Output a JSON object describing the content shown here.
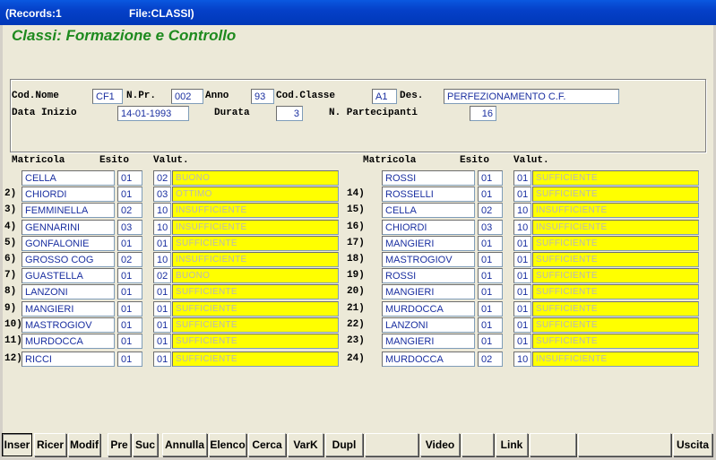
{
  "window": {
    "records": "(Records:1",
    "file": "File:CLASSI)"
  },
  "form": {
    "title": "Classi: Formazione e Controllo"
  },
  "header": {
    "cod_nome": {
      "label": "Cod.Nome",
      "value": "CF1"
    },
    "n_pr": {
      "label": "N.Pr.",
      "value": "002"
    },
    "anno": {
      "label": "Anno",
      "value": "93"
    },
    "cod_classe": {
      "label": "Cod.Classe",
      "value": "A1"
    },
    "des": {
      "label": "Des.",
      "value": "PERFEZIONAMENTO C.F."
    },
    "data_inizio": {
      "label": "Data Inizio",
      "value": "14-01-1993"
    },
    "durata": {
      "label": "Durata",
      "value": "3"
    },
    "n_partecipanti": {
      "label": "N. Partecipanti",
      "value": "16"
    }
  },
  "columns": {
    "matricola": "Matricola",
    "esito": "Esito",
    "valut": "Valut."
  },
  "left_rows": [
    {
      "num": "",
      "matricola": "CELLA",
      "esito": "01",
      "code": "02",
      "desc": "BUONO"
    },
    {
      "num": "2)",
      "matricola": "CHIORDI",
      "esito": "01",
      "code": "03",
      "desc": "OTTIMO"
    },
    {
      "num": "3)",
      "matricola": "FEMMINELLA",
      "esito": "02",
      "code": "10",
      "desc": "INSUFFICIENTE"
    },
    {
      "num": "4)",
      "matricola": "GENNARINI",
      "esito": "03",
      "code": "10",
      "desc": "INSUFFICIENTE"
    },
    {
      "num": "5)",
      "matricola": "GONFALONIE",
      "esito": "01",
      "code": "01",
      "desc": "SUFFICIENTE"
    },
    {
      "num": "6)",
      "matricola": "GROSSO COG",
      "esito": "02",
      "code": "10",
      "desc": "INSUFFICIENTE"
    },
    {
      "num": "7)",
      "matricola": "GUASTELLA",
      "esito": "01",
      "code": "02",
      "desc": "BUONO"
    },
    {
      "num": "8)",
      "matricola": "LANZONI",
      "esito": "01",
      "code": "01",
      "desc": "SUFFICIENTE"
    },
    {
      "num": "9)",
      "matricola": "MANGIERI",
      "esito": "01",
      "code": "01",
      "desc": "SUFFICIENTE"
    },
    {
      "num": "10)",
      "matricola": "MASTROGIOV",
      "esito": "01",
      "code": "01",
      "desc": "SUFFICIENTE"
    },
    {
      "num": "11)",
      "matricola": "MURDOCCA",
      "esito": "01",
      "code": "01",
      "desc": "SUFFICIENTE"
    },
    {
      "num": "12)",
      "matricola": "RICCI",
      "esito": "01",
      "code": "01",
      "desc": "SUFFICIENTE"
    }
  ],
  "right_rows": [
    {
      "num": "",
      "matricola": "ROSSI",
      "esito": "01",
      "code": "01",
      "desc": "SUFFICIENTE"
    },
    {
      "num": "14)",
      "matricola": "ROSSELLI",
      "esito": "01",
      "code": "01",
      "desc": "SUFFICIENTE"
    },
    {
      "num": "15)",
      "matricola": "CELLA",
      "esito": "02",
      "code": "10",
      "desc": "INSUFFICIENTE"
    },
    {
      "num": "16)",
      "matricola": "CHIORDI",
      "esito": "03",
      "code": "10",
      "desc": "INSUFFICIENTE"
    },
    {
      "num": "17)",
      "matricola": "MANGIERI",
      "esito": "01",
      "code": "01",
      "desc": "SUFFICIENTE"
    },
    {
      "num": "18)",
      "matricola": "MASTROGIOV",
      "esito": "01",
      "code": "01",
      "desc": "SUFFICIENTE"
    },
    {
      "num": "19)",
      "matricola": "ROSSI",
      "esito": "01",
      "code": "01",
      "desc": "SUFFICIENTE"
    },
    {
      "num": "20)",
      "matricola": "MANGIERI",
      "esito": "01",
      "code": "01",
      "desc": "SUFFICIENTE"
    },
    {
      "num": "21)",
      "matricola": "MURDOCCA",
      "esito": "01",
      "code": "01",
      "desc": "SUFFICIENTE"
    },
    {
      "num": "22)",
      "matricola": "LANZONI",
      "esito": "01",
      "code": "01",
      "desc": "SUFFICIENTE"
    },
    {
      "num": "23)",
      "matricola": "MANGIERI",
      "esito": "01",
      "code": "01",
      "desc": "SUFFICIENTE"
    },
    {
      "num": "24)",
      "matricola": "MURDOCCA",
      "esito": "02",
      "code": "10",
      "desc": "INSUFFICIENTE"
    }
  ],
  "toolbar": {
    "inser": "Inser",
    "ricer": "Ricer",
    "modif": "Modif",
    "pre": "Pre",
    "suc": "Suc",
    "annulla": "Annulla",
    "elenco": "Elenco",
    "cerca": "Cerca",
    "vark": "VarK",
    "dupl": "Dupl",
    "video": "Video",
    "link": "Link",
    "uscita": "Uscita"
  }
}
